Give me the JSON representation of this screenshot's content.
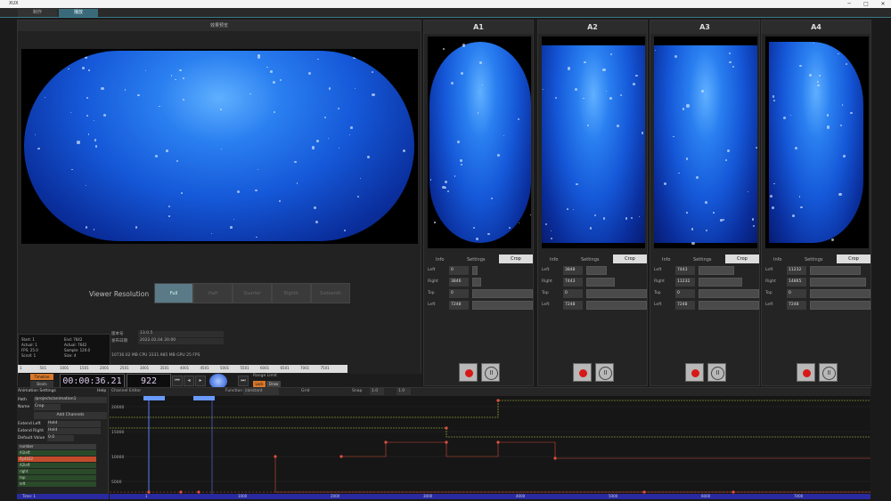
{
  "titlebar": {
    "title": "XUX"
  },
  "tabs": [
    {
      "label": "制作",
      "active": false
    },
    {
      "label": "播放",
      "active": true
    }
  ],
  "main": {
    "title": "效果预览",
    "viewer_resolution_label": "Viewer Resolution",
    "resolutions": [
      {
        "label": "Full",
        "selected": true
      },
      {
        "label": "Half",
        "selected": false
      },
      {
        "label": "Quarter",
        "selected": false
      },
      {
        "label": "Eighth",
        "selected": false
      },
      {
        "label": "Sixteenth",
        "selected": false
      }
    ],
    "stats": [
      "Start: 1",
      "End: 7642",
      "Actual: 1",
      "Actual: 7642",
      "FPS: 25.0",
      "Sample: 120.0",
      "Scroll: 1",
      "Size: 4"
    ],
    "version_label": "版本号",
    "version_value": "13.0.5",
    "date_label": "发布日期",
    "date_value": "2022.02.04 20:00",
    "status": "10736.02 MB CPU   3331.985 MB GPU   25 FPS",
    "ruler_ticks": [
      "1",
      "501",
      "1001",
      "1501",
      "2001",
      "2501",
      "3001",
      "3501",
      "4001",
      "4501",
      "5001",
      "5501",
      "6001",
      "6501",
      "7001",
      "7501"
    ],
    "timecode": "00:00:36.21",
    "frame": "922",
    "range_limit": "Range Limit",
    "range_a": "Lock",
    "range_b": "Draw",
    "btn_a": "Timeline",
    "btn_b": "Beats"
  },
  "outputs": [
    {
      "name": "A1",
      "info": "Info",
      "settings": "Settings",
      "crop": "Crop",
      "left": "0",
      "right": "3846",
      "top": "0",
      "left2": "7248",
      "bar_right": 0.15
    },
    {
      "name": "A2",
      "info": "Info",
      "settings": "Settings",
      "crop": "Crop",
      "left": "3848",
      "right": "7443",
      "top": "0",
      "left2": "7248",
      "bar_right": 0.47
    },
    {
      "name": "A3",
      "info": "Info",
      "settings": "Settings",
      "crop": "Crop",
      "left": "7443",
      "right": "11232",
      "top": "0",
      "left2": "7248",
      "bar_right": 0.72
    },
    {
      "name": "A4",
      "info": "Info",
      "settings": "Settings",
      "crop": "Crop",
      "left": "11232",
      "right": "14865",
      "top": "0",
      "left2": "7248",
      "bar_right": 0.93
    }
  ],
  "field_labels": {
    "left": "Left",
    "right": "Right",
    "top": "Top",
    "lft": "Left"
  },
  "anim": {
    "title": "Animation Settings",
    "help": "Help",
    "path_label": "Path",
    "path_value": "/projects/animation1",
    "name_label": "Name",
    "name_value": "Crop",
    "add_channels": "Add Channels",
    "extend_left_label": "Extend Left",
    "extend_left_value": "Hold",
    "extend_right_label": "Extend Right",
    "extend_right_value": "Hold",
    "default_label": "Default Value",
    "default_value": "0.0",
    "channels": [
      {
        "name": "number",
        "color": "#3a3a3a"
      },
      {
        "name": "A1left",
        "color": "#2a4a2a"
      },
      {
        "name": "fly4422",
        "color": "#c04a2a"
      },
      {
        "name": "A2left",
        "color": "#2a4a2a"
      },
      {
        "name": "right",
        "color": "#2a4a2a"
      },
      {
        "name": "top",
        "color": "#2a4a2a"
      },
      {
        "name": "left",
        "color": "#2a4a2a"
      }
    ],
    "channel_editor": "Channel Editor",
    "function_label": "Function",
    "function_value": "constant",
    "grid_label": "Grid",
    "snap_label": "Snap",
    "snap_value": "1.0",
    "zoom_value": "1.0",
    "y_ticks": [
      "20000",
      "15000",
      "10000",
      "5000"
    ],
    "x_ticks": [
      "1",
      "1000",
      "2000",
      "3000",
      "4000",
      "5000",
      "6000",
      "7000"
    ],
    "time_label": "Time: 1"
  }
}
